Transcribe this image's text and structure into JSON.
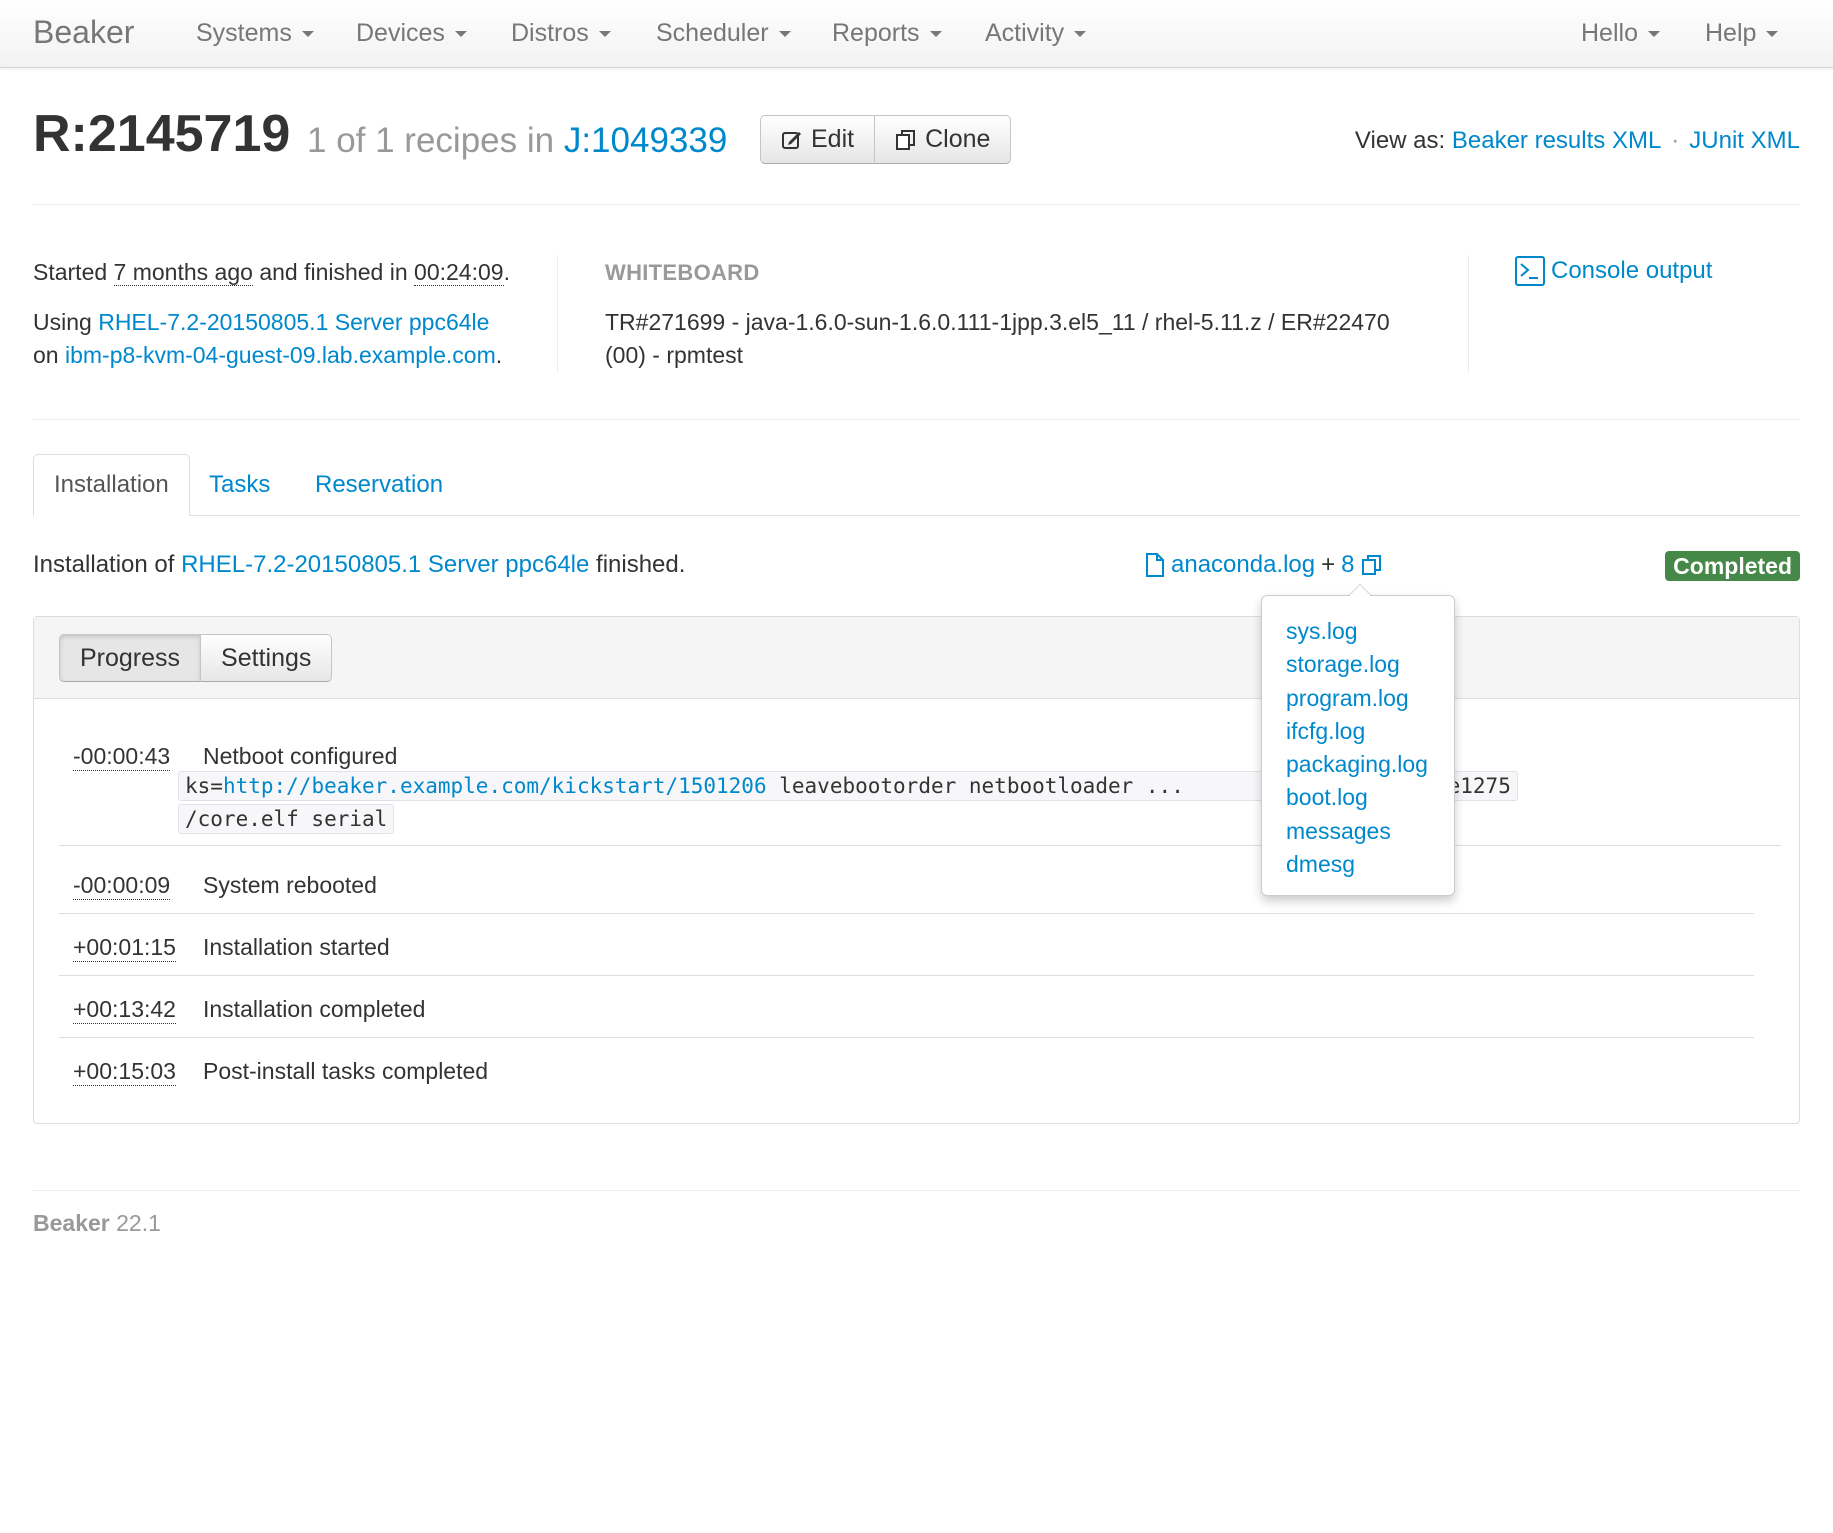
{
  "nav": {
    "brand": "Beaker",
    "left_items": [
      "Systems",
      "Devices",
      "Distros",
      "Scheduler",
      "Reports",
      "Activity"
    ],
    "right_items": [
      "Hello",
      "Help"
    ]
  },
  "header": {
    "recipe_id": "R:2145719",
    "subtitle_prefix": "1 of 1 recipes in",
    "job_link": "J:1049339",
    "edit_label": "Edit",
    "clone_label": "Clone",
    "view_as_label": "View as:",
    "view_as_links": [
      "Beaker results XML",
      "JUnit XML"
    ],
    "view_as_sep": "·"
  },
  "summary": {
    "started_prefix": "Started",
    "started_ago": "7 months ago",
    "finished_mid": "and finished in",
    "duration": "00:24:09",
    "using_prefix": "Using",
    "distro": "RHEL-7.2-20150805.1 Server ppc64le",
    "on_prefix": "on",
    "system": "ibm-p8-kvm-04-guest-09.lab.example.com",
    "whiteboard_heading": "WHITEBOARD",
    "whiteboard_text": "TR#271699 - java-1.6.0-sun-1.6.0.111-1jpp.3.el5_11 / rhel-5.11.z / ER#22470 (00) - rpmtest",
    "console_label": "Console output"
  },
  "tabs": [
    "Installation",
    "Tasks",
    "Reservation"
  ],
  "installation": {
    "prefix": "Installation of",
    "distro": "RHEL-7.2-20150805.1 Server ppc64le",
    "suffix": "finished.",
    "main_log": "anaconda.log",
    "plus": "+",
    "more_count": "8",
    "status": "Completed",
    "status_color": "#468847",
    "other_logs": [
      "sys.log",
      "storage.log",
      "program.log",
      "ifcfg.log",
      "packaging.log",
      "boot.log",
      "messages",
      "dmesg"
    ]
  },
  "panel": {
    "progress_label": "Progress",
    "settings_label": "Settings",
    "events": [
      {
        "time": "-00:00:43",
        "desc": "Netboot configured"
      },
      {
        "time": "-00:00:09",
        "desc": "System rebooted"
      },
      {
        "time": "+00:01:15",
        "desc": "Installation started"
      },
      {
        "time": "+00:13:42",
        "desc": "Installation completed"
      },
      {
        "time": "+00:15:03",
        "desc": "Post-install tasks completed"
      }
    ],
    "netboot_cmd": {
      "ks_prefix": "ks=",
      "ks_url": "http://beaker.example.com/kickstart/1501206",
      "line1_rest": "leavebootorder netbootloader",
      "line1_tail": "werpc-ieee1275",
      "line2": "/core.elf serial"
    }
  },
  "footer": {
    "name": "Beaker",
    "version": "22.1"
  }
}
